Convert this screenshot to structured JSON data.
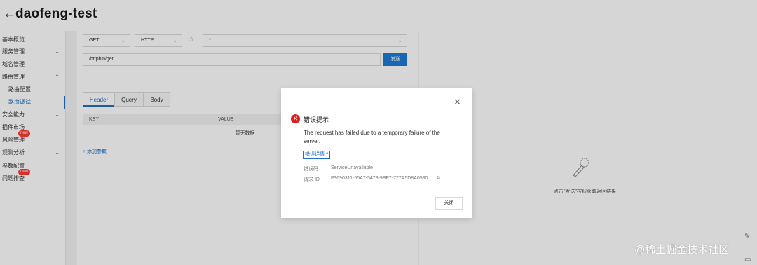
{
  "header": {
    "back_glyph": "←",
    "title": "daofeng-test"
  },
  "sidebar": {
    "items": [
      {
        "label": "基本概览"
      },
      {
        "label": "服务管理",
        "chevron": "⌄"
      },
      {
        "label": "域名管理"
      },
      {
        "label": "路由管理",
        "chevron": "⌃"
      },
      {
        "label": "路由配置"
      },
      {
        "label": "路由调试"
      },
      {
        "label": "安全能力",
        "chevron": "⌄"
      },
      {
        "label": "插件市场"
      },
      {
        "label": "风险管理",
        "badge": "new"
      },
      {
        "label": "观测分析",
        "chevron": "⌄"
      },
      {
        "label": "参数配置"
      },
      {
        "label": "问题排查",
        "badge": "new"
      }
    ]
  },
  "request": {
    "method": "GET",
    "protocol": "HTTP",
    "separator": "://",
    "host": "*",
    "path": "/httpbin/get",
    "send_label": "发送"
  },
  "tabs": [
    {
      "label": "Header"
    },
    {
      "label": "Query"
    },
    {
      "label": "Body"
    }
  ],
  "params_table": {
    "columns": [
      "KEY",
      "VALUE"
    ],
    "empty_text": "暂无数据",
    "add_label": "+ 添加参数"
  },
  "response_panel": {
    "hint": "点击\"发送\"按钮获取返回结果"
  },
  "modal": {
    "title": "错误提示",
    "message": "The request has failed due to a temporary failure of the server.",
    "detail_toggle": "错误详情 ^",
    "error_code_label": "错误码",
    "error_code_value": "ServiceUnavailable",
    "request_id_label": "请求 ID",
    "request_id_value": "F3690311-55A7-5478-9BF7-777A5D8A0580",
    "close_button": "关闭"
  },
  "watermark": "@稀土掘金技术社区",
  "colors": {
    "accent": "#1e7bd4",
    "error": "#e02020",
    "badge": "#ff3b30"
  }
}
